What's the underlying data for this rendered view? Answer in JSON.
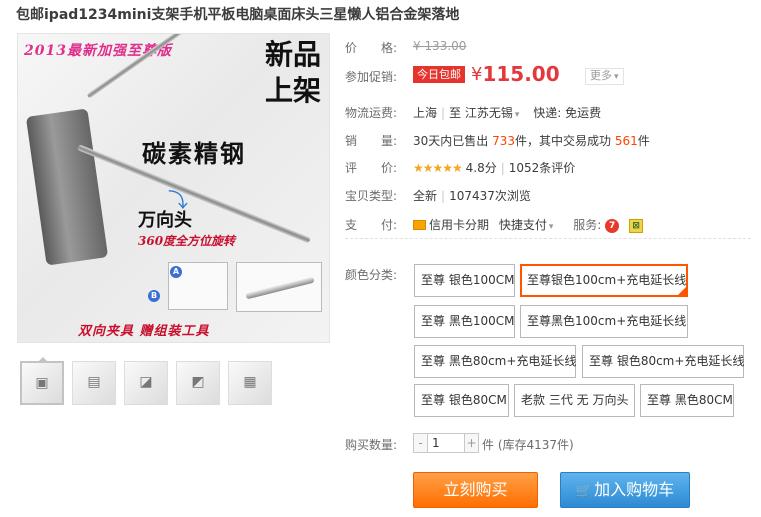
{
  "product": {
    "title": "包邮ipad1234mini支架手机平板电脑桌面床头三星懒人铝合金架落地"
  },
  "main_image": {
    "banner": "2013最新加强至尊版",
    "new_line1": "新品",
    "new_line2": "上架",
    "carbon": "碳素精钢",
    "universal": "万向头",
    "rotate": "360度全方位旋转",
    "bottom": "双向夹具  赠组装工具",
    "letter_a": "A",
    "letter_b": "B"
  },
  "thumbnails": [
    {
      "label": "thumb-1"
    },
    {
      "label": "thumb-2"
    },
    {
      "label": "thumb-3"
    },
    {
      "label": "thumb-4"
    },
    {
      "label": "thumb-5"
    }
  ],
  "price": {
    "label": "价　　格:",
    "original": "¥ 133.00"
  },
  "promo": {
    "label": "参加促销:",
    "badge": "今日包邮",
    "currency": "¥",
    "price": "115.00",
    "more": "更多"
  },
  "shipping": {
    "label": "物流运费:",
    "from": "上海",
    "to_prefix": "至",
    "to": "江苏无锡",
    "express": "快递: 免运费"
  },
  "sales": {
    "label": "销　　量:",
    "text1": "30天内已售出",
    "sold": "733",
    "text2": "件，其中交易成功",
    "success": "561",
    "text3": "件"
  },
  "rating": {
    "label": "评　　价:",
    "stars": "★★★★★",
    "score": "4.8分",
    "reviews": "1052条评价"
  },
  "condition": {
    "label": "宝贝类型:",
    "value": "全新",
    "views": "107437次浏览"
  },
  "payment": {
    "label": "支　　付:",
    "credit": "信用卡分期",
    "quick": "快捷支付",
    "service_label": "服务:",
    "service_icon1": "7",
    "service_icon2": "⊠"
  },
  "sku": {
    "label": "颜色分类:",
    "options": [
      "至尊 银色100CM",
      "至尊银色100cm+充电延长线",
      "至尊 黑色100CM",
      "至尊黑色100cm+充电延长线",
      "至尊 黑色80cm+充电延长线",
      "至尊 银色80cm+充电延长线",
      "至尊 银色80CM",
      "老款 三代 无 万向头",
      "至尊 黑色80CM"
    ]
  },
  "quantity": {
    "label": "购买数量:",
    "value": "1",
    "minus": "-",
    "plus": "+",
    "unit": "件 (库存4137件)"
  },
  "buttons": {
    "buy": "立刻购买",
    "cart": "加入购物车"
  },
  "colors": {
    "accent": "#ff5500",
    "price_red": "#e4393c",
    "buy_orange": "#ff7a00",
    "cart_blue": "#3b94dc"
  }
}
